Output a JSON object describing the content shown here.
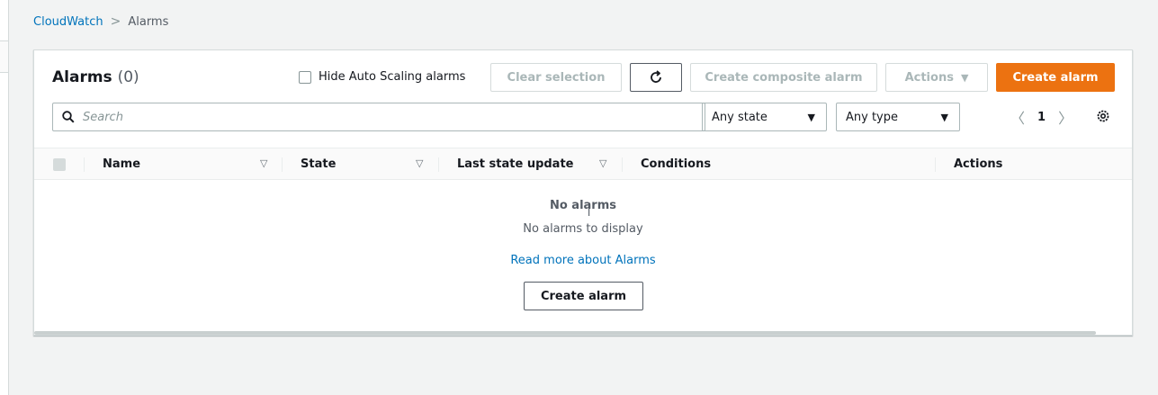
{
  "breadcrumb": {
    "root": "CloudWatch",
    "separator": ">",
    "current": "Alarms"
  },
  "panel": {
    "title": "Alarms",
    "count": "(0)",
    "hide_autoscaling_label": "Hide Auto Scaling alarms",
    "hide_autoscaling_checked": false,
    "buttons": {
      "clear_selection": "Clear selection",
      "create_composite": "Create composite alarm",
      "actions": "Actions",
      "create_alarm": "Create alarm"
    },
    "search": {
      "placeholder": "Search"
    },
    "filters": {
      "state": "Any state",
      "type": "Any type"
    },
    "pagination": {
      "page": "1"
    }
  },
  "table": {
    "columns": [
      "Name",
      "State",
      "Last state update",
      "Conditions",
      "Actions"
    ]
  },
  "empty": {
    "title": "No alarms",
    "subtitle": "No alarms to display",
    "link": "Read more about Alarms",
    "button": "Create alarm"
  },
  "colors": {
    "primary": "#ec7211",
    "link": "#0073bb",
    "text": "#16191f"
  },
  "icons": [
    "search-icon",
    "refresh-icon",
    "settings-icon",
    "chevron-left-icon",
    "chevron-right-icon",
    "caret-down-icon",
    "sort-icon"
  ]
}
